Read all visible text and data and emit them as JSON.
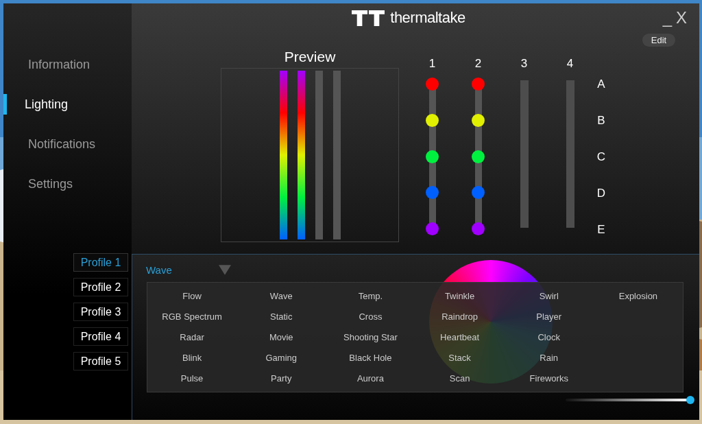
{
  "window": {
    "logo_text": "thermaltake",
    "minimize": "_",
    "close": "X"
  },
  "sidebar": {
    "items": [
      {
        "label": "Information",
        "selected": false
      },
      {
        "label": "Lighting",
        "selected": true
      },
      {
        "label": "Notifications",
        "selected": false
      },
      {
        "label": "Settings",
        "selected": false
      }
    ]
  },
  "profiles": [
    {
      "label": "Profile 1",
      "selected": true
    },
    {
      "label": "Profile 2",
      "selected": false
    },
    {
      "label": "Profile 3",
      "selected": false
    },
    {
      "label": "Profile 4",
      "selected": false
    },
    {
      "label": "Profile 5",
      "selected": false
    }
  ],
  "edit_button": "Edit",
  "preview": {
    "title": "Preview"
  },
  "channels": [
    {
      "label": "1",
      "leds": [
        {
          "color": "#ff0000"
        },
        {
          "color": "#e0f000"
        },
        {
          "color": "#00f040"
        },
        {
          "color": "#0060ff"
        },
        {
          "color": "#a000ff"
        }
      ]
    },
    {
      "label": "2",
      "leds": [
        {
          "color": "#ff0000"
        },
        {
          "color": "#e0f000"
        },
        {
          "color": "#00f040"
        },
        {
          "color": "#0060ff"
        },
        {
          "color": "#a000ff"
        }
      ]
    },
    {
      "label": "3"
    },
    {
      "label": "4"
    }
  ],
  "led_rows": [
    "A",
    "B",
    "C",
    "D",
    "E"
  ],
  "mode_dropdown": {
    "value": "Wave",
    "expanded": true
  },
  "mode_menu": [
    [
      "Flow",
      "RGB Spectrum",
      "Radar",
      "Blink",
      "Pulse"
    ],
    [
      "Wave",
      "Static",
      "Movie",
      "Gaming",
      "Party"
    ],
    [
      "Temp.",
      "Cross",
      "Shooting Star",
      "Black Hole",
      "Aurora"
    ],
    [
      "Twinkle",
      "Raindrop",
      "Heartbeat",
      "Stack",
      "Scan"
    ],
    [
      "Swirl",
      "Player",
      "Clock",
      "Rain",
      "Fireworks"
    ],
    [
      "Explosion"
    ]
  ],
  "brightness_slider": {
    "level": 1.0
  }
}
